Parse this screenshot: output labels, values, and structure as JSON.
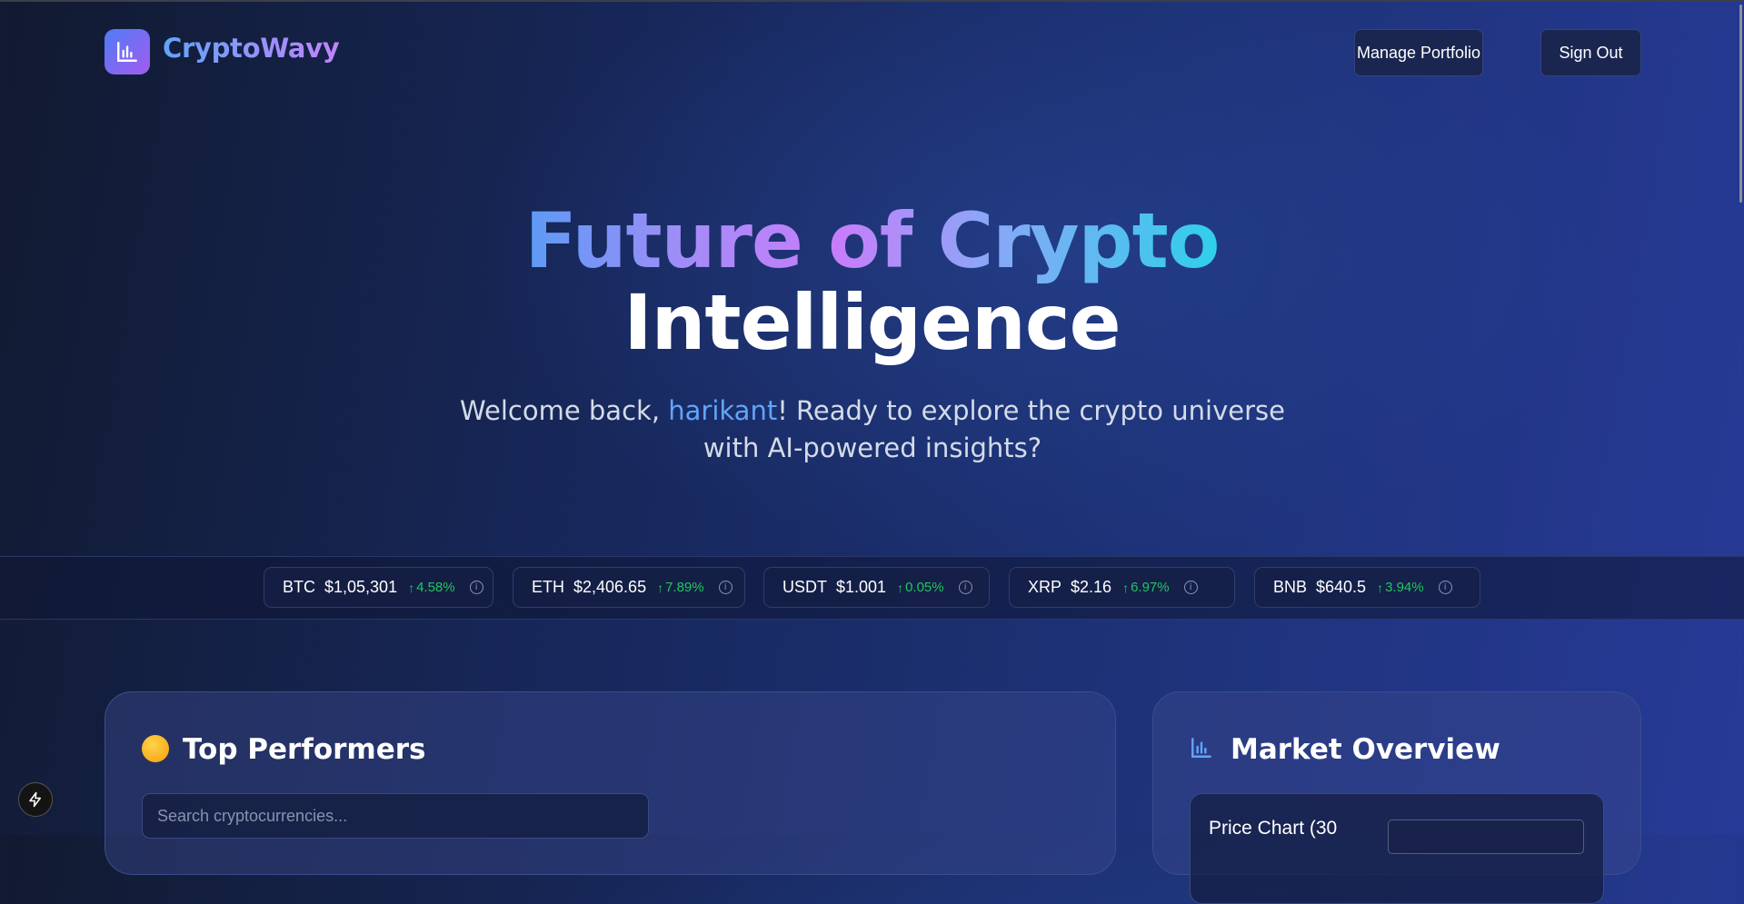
{
  "header": {
    "brand": "CryptoWavy",
    "logo_icon": "bar-chart-icon",
    "manage_portfolio_label": "Manage Portfolio",
    "sign_out_label": "Sign Out"
  },
  "hero": {
    "title_line1": "Future of Crypto",
    "title_line2": "Intelligence",
    "welcome_prefix": "Welcome back, ",
    "username": "harikant",
    "welcome_suffix": "! Ready to explore the crypto universe with AI-powered insights?"
  },
  "ticker": [
    {
      "symbol": "BTC",
      "price": "$1,05,301",
      "change": "4.58%"
    },
    {
      "symbol": "ETH",
      "price": "$2,406.65",
      "change": "7.89%"
    },
    {
      "symbol": "USDT",
      "price": "$1.001",
      "change": "0.05%"
    },
    {
      "symbol": "XRP",
      "price": "$2.16",
      "change": "6.97%"
    },
    {
      "symbol": "BNB",
      "price": "$640.5",
      "change": "3.94%"
    }
  ],
  "top_performers": {
    "title": "Top Performers",
    "search_placeholder": "Search cryptocurrencies..."
  },
  "market_overview": {
    "title": "Market Overview",
    "price_chart_label": "Price Chart (30"
  },
  "colors": {
    "accent_blue": "#60a5fa",
    "accent_purple": "#c084fc",
    "positive_green": "#22c55e"
  }
}
